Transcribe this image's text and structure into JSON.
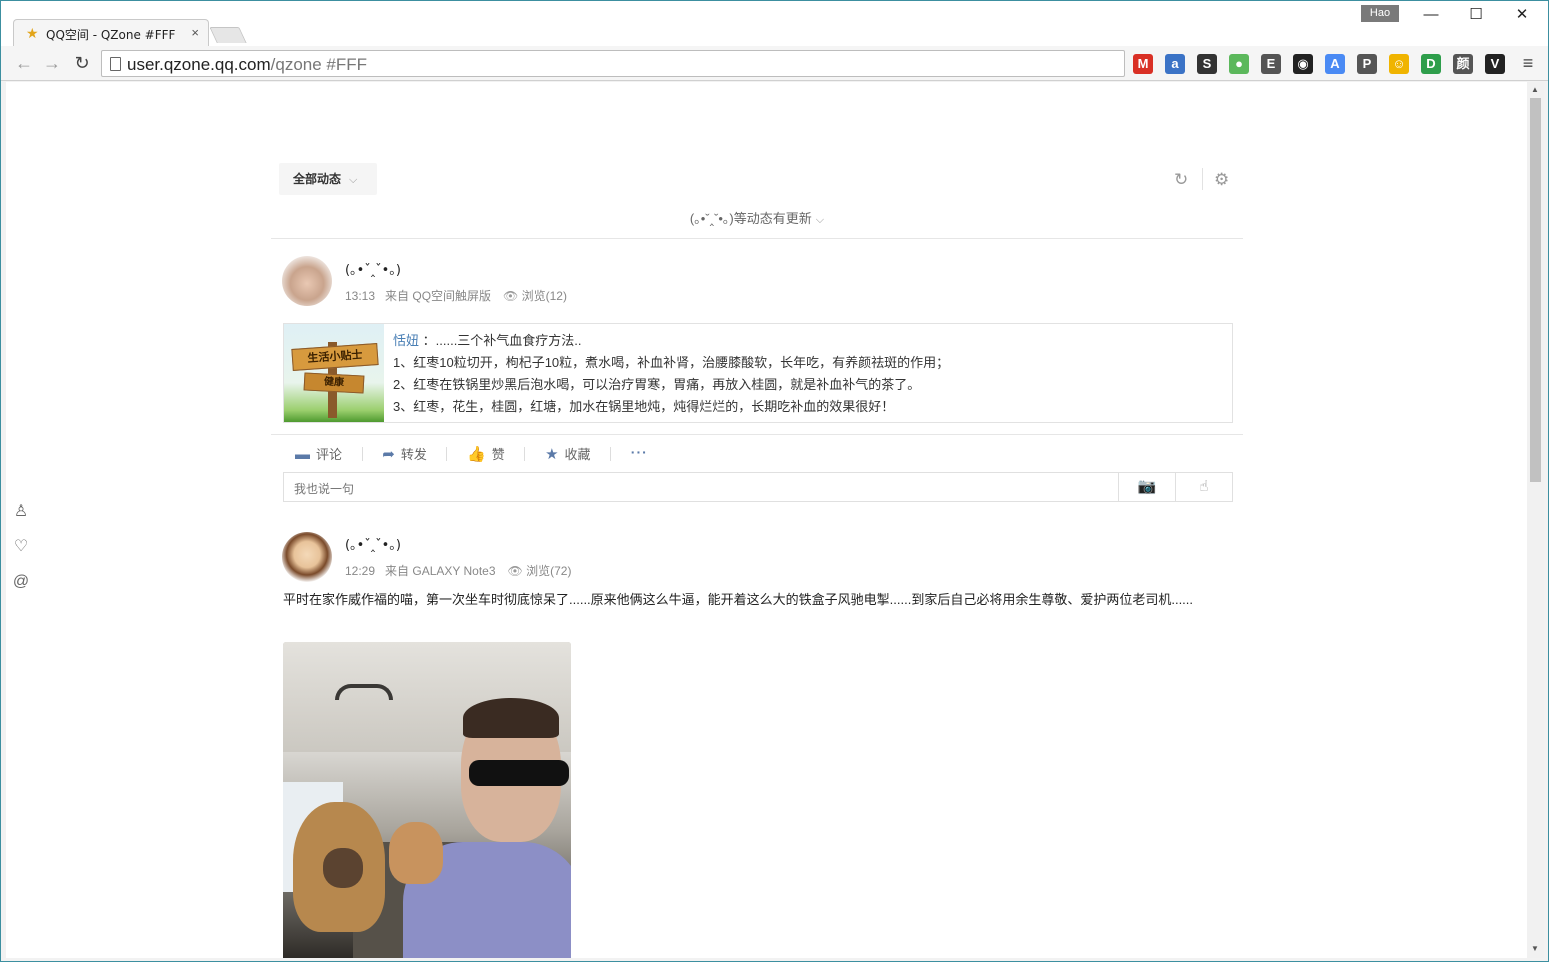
{
  "browser": {
    "tab_title": "QQ空间 - QZone #FFF",
    "tab_close": "×",
    "profile_name": "Hao",
    "url_host": "user.qzone.qq.com",
    "url_path": "/qzone #FFF",
    "window_controls": {
      "minimize": "—",
      "maximize": "☐",
      "close": "✕"
    },
    "extensions": [
      {
        "name": "gmail-icon",
        "glyph": "M",
        "color": "#d93025"
      },
      {
        "name": "extension-icon-2",
        "glyph": "a",
        "color": "#3b73c6"
      },
      {
        "name": "extension-icon-3",
        "glyph": "S",
        "color": "#333333"
      },
      {
        "name": "extension-icon-4",
        "glyph": "●",
        "color": "#5cb85c"
      },
      {
        "name": "evernote-icon",
        "glyph": "E",
        "color": "#555555"
      },
      {
        "name": "color-picker-icon",
        "glyph": "◉",
        "color": "#222222"
      },
      {
        "name": "translate-icon",
        "glyph": "A",
        "color": "#4a8af4"
      },
      {
        "name": "pocket-icon",
        "glyph": "P",
        "color": "#555555"
      },
      {
        "name": "emoji-icon",
        "glyph": "☺",
        "color": "#f0b400"
      },
      {
        "name": "extension-icon-10",
        "glyph": "D",
        "color": "#2e9e4b"
      },
      {
        "name": "extension-icon-11",
        "glyph": "颜",
        "color": "#555555"
      },
      {
        "name": "extension-icon-12",
        "glyph": "V",
        "color": "#222222"
      }
    ],
    "menu_glyph": "≡"
  },
  "feed": {
    "filter_label": "全部动态",
    "update_notice": "(｡•ˇ‸ˇ•｡)等动态有更新",
    "posts": [
      {
        "poster": "(｡•ˇ‸ˇ•｡)",
        "time": "13:13",
        "source": "来自 QQ空间触屏版",
        "views": "浏览(12)",
        "share": {
          "image_text_1": "生活小贴士",
          "image_text_2": "健康",
          "author": "恬妞",
          "lines": [
            "：......三个补气血食疗方法..",
            "1、红枣10粒切开，枸杞子10粒，煮水喝，补血补肾，治腰膝酸软，长年吃，有养颜祛斑的作用；",
            "2、红枣在铁锅里炒黑后泡水喝，可以治疗胃寒，胃痛，再放入桂圆，就是补血补气的茶了。",
            "3、红枣，花生，桂圆，红塘，加水在锅里地炖，炖得烂烂的，长期吃补血的效果很好！"
          ]
        },
        "actions": {
          "comment": "评论",
          "forward": "转发",
          "like": "赞",
          "favorite": "收藏",
          "more": "···"
        },
        "comment_placeholder": "我也说一句"
      },
      {
        "poster": "(｡•ˇ‸ˇ•｡)",
        "time": "12:29",
        "source": "来自 GALAXY Note3",
        "views": "浏览(72)",
        "text": "平时在家作威作福的喵，第一次坐车时彻底惊呆了......原来他俩这么牛逼，能开着这么大的铁盒子风驰电掣......到家后自己必将用余生尊敬、爱护两位老司机......"
      }
    ]
  }
}
